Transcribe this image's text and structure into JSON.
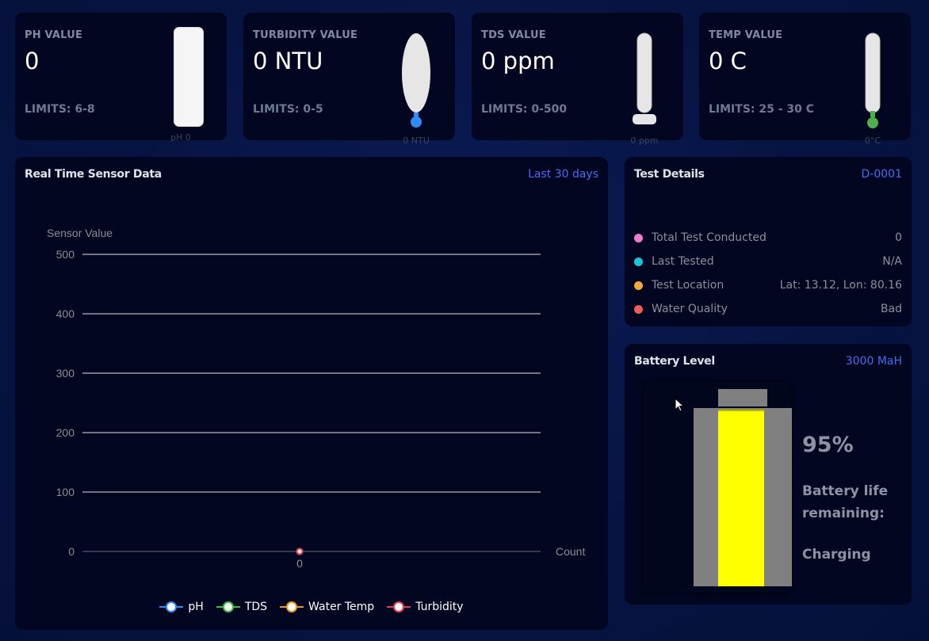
{
  "metrics": [
    {
      "label": "PH VALUE",
      "value": "0",
      "limits": "LIMITS: 6-8",
      "gauge_caption": "pH 0"
    },
    {
      "label": "TURBIDITY VALUE",
      "value": "0 NTU",
      "limits": "LIMITS: 0-5",
      "gauge_caption": "0 NTU"
    },
    {
      "label": "TDS VALUE",
      "value": "0 ppm",
      "limits": "LIMITS: 0-500",
      "gauge_caption": "0 ppm"
    },
    {
      "label": "TEMP VALUE",
      "value": "0 C",
      "limits": "LIMITS: 25 - 30 C",
      "gauge_caption": "0°C"
    }
  ],
  "sensor_panel": {
    "title": "Real Time Sensor Data",
    "period": "Last 30 days"
  },
  "chart_data": {
    "type": "line",
    "ylabel": "Sensor Value",
    "xlabel": "Count",
    "ylim": [
      0,
      500
    ],
    "yticks": [
      "0",
      "100",
      "200",
      "300",
      "400",
      "500"
    ],
    "categories": [
      "0"
    ],
    "grid": true,
    "legend_position": "bottom",
    "series": [
      {
        "name": "pH",
        "values": [
          0
        ],
        "color": "#2f8cf5"
      },
      {
        "name": "TDS",
        "values": [
          0
        ],
        "color": "#37c43a"
      },
      {
        "name": "Water Temp",
        "values": [
          0
        ],
        "color": "#f29a16"
      },
      {
        "name": "Turbidity",
        "values": [
          0
        ],
        "color": "#e8384f"
      }
    ]
  },
  "test_details": {
    "title": "Test Details",
    "id": "D-0001",
    "rows": [
      {
        "label": "Total Test Conducted",
        "value": "0",
        "color": "#f07ccf"
      },
      {
        "label": "Last Tested",
        "value": "N/A",
        "color": "#18c4d6"
      },
      {
        "label": "Test Location",
        "value": "Lat: 13.12, Lon: 80.16",
        "color": "#f2a93b"
      },
      {
        "label": "Water Quality",
        "value": "Bad",
        "color": "#f05a5a"
      }
    ]
  },
  "battery": {
    "title": "Battery Level",
    "capacity": "3000 MaH",
    "level": 0.95,
    "percent_text": "95%",
    "life_label_1": "Battery life",
    "life_label_2": "remaining:",
    "status": "Charging",
    "fill_color": "#ffff00"
  }
}
